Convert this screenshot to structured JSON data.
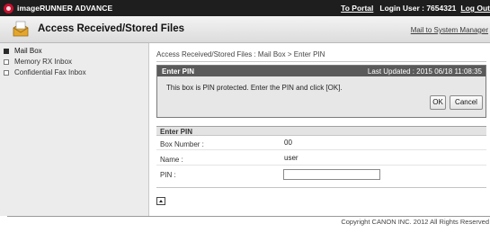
{
  "topbar": {
    "brand": "imageRUNNER ADVANCE",
    "to_portal": "To Portal",
    "login_user": "Login User : 7654321",
    "log_out": "Log Out"
  },
  "titlebar": {
    "title": "Access Received/Stored Files",
    "mail_link": "Mail to System Manager"
  },
  "sidebar": {
    "items": [
      {
        "label": "Mail Box",
        "active": true
      },
      {
        "label": "Memory RX Inbox",
        "active": false
      },
      {
        "label": "Confidential Fax Inbox",
        "active": false
      }
    ]
  },
  "main": {
    "breadcrumb": "Access Received/Stored Files : Mail Box > Enter PIN",
    "pin_box": {
      "header": "Enter PIN",
      "last_updated": "Last Updated : 2015 06/18 11:08:35",
      "message": "This box is PIN protected. Enter the PIN and click [OK].",
      "ok_label": "OK",
      "cancel_label": "Cancel"
    },
    "form": {
      "header": "Enter PIN",
      "box_number_label": "Box Number :",
      "box_number_value": "00",
      "name_label": "Name :",
      "name_value": "user",
      "pin_label": "PIN :",
      "pin_value": ""
    }
  },
  "footer": {
    "copyright": "Copyright CANON INC. 2012 All Rights Reserved"
  },
  "colors": {
    "topbar_bg": "#1e1e1e",
    "panel_header_bg": "#5a5a5a",
    "sidebar_bg": "#ececec",
    "logo_red": "#c8102e"
  }
}
